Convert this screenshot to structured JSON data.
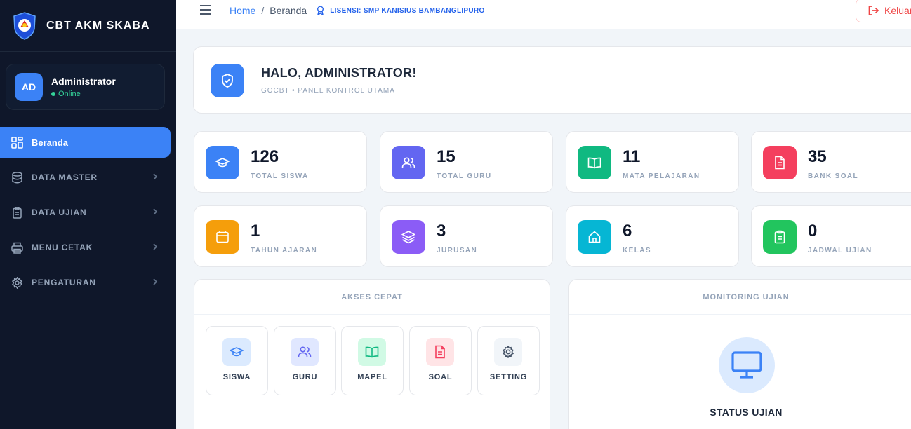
{
  "brand": {
    "title": "CBT AKM SKABA"
  },
  "user": {
    "initials": "AD",
    "name": "Administrator",
    "status": "Online"
  },
  "sidebar": {
    "items": [
      {
        "label": "Beranda",
        "icon": "grid-icon",
        "active": true
      },
      {
        "label": "DATA MASTER",
        "icon": "database-icon"
      },
      {
        "label": "DATA UJIAN",
        "icon": "clipboard-icon"
      },
      {
        "label": "MENU CETAK",
        "icon": "printer-icon"
      },
      {
        "label": "PENGATURAN",
        "icon": "gear-icon"
      }
    ]
  },
  "topbar": {
    "breadcrumb_home": "Home",
    "breadcrumb_sep": "/",
    "breadcrumb_current": "Beranda",
    "license": "LISENSI: SMP KANISIUS BAMBANGLIPURO",
    "logout_label": "Keluar"
  },
  "welcome": {
    "title": "HALO, ADMINISTRATOR!",
    "subtitle": "GOCBT • PANEL KONTROL UTAMA"
  },
  "stats": [
    {
      "value": "126",
      "label": "TOTAL SISWA",
      "color": "#3b82f6",
      "icon": "graduation-cap-icon"
    },
    {
      "value": "15",
      "label": "TOTAL GURU",
      "color": "#6366f1",
      "icon": "users-icon"
    },
    {
      "value": "11",
      "label": "MATA PELAJARAN",
      "color": "#10b981",
      "icon": "book-icon"
    },
    {
      "value": "35",
      "label": "BANK SOAL",
      "color": "#f43f5e",
      "icon": "document-icon"
    },
    {
      "value": "1",
      "label": "TAHUN AJARAN",
      "color": "#f59e0b",
      "icon": "calendar-icon"
    },
    {
      "value": "3",
      "label": "JURUSAN",
      "color": "#8b5cf6",
      "icon": "layers-icon"
    },
    {
      "value": "6",
      "label": "KELAS",
      "color": "#06b6d4",
      "icon": "home-icon"
    },
    {
      "value": "0",
      "label": "JADWAL UJIAN",
      "color": "#22c55e",
      "icon": "clipboard-check-icon"
    }
  ],
  "quick_access": {
    "title": "AKSES CEPAT",
    "items": [
      {
        "label": "SISWA",
        "icon": "graduation-cap-icon",
        "bg": "#dbeafe",
        "fg": "#3b82f6"
      },
      {
        "label": "GURU",
        "icon": "users-icon",
        "bg": "#e0e7ff",
        "fg": "#6366f1"
      },
      {
        "label": "MAPEL",
        "icon": "book-icon",
        "bg": "#d1fae5",
        "fg": "#10b981"
      },
      {
        "label": "SOAL",
        "icon": "document-icon",
        "bg": "#ffe4e6",
        "fg": "#f43f5e"
      },
      {
        "label": "SETTING",
        "icon": "gear-icon",
        "bg": "#f1f5f9",
        "fg": "#475569"
      }
    ]
  },
  "monitoring": {
    "title": "MONITORING UJIAN",
    "status_title": "STATUS UJIAN",
    "icon": "monitor-icon"
  }
}
